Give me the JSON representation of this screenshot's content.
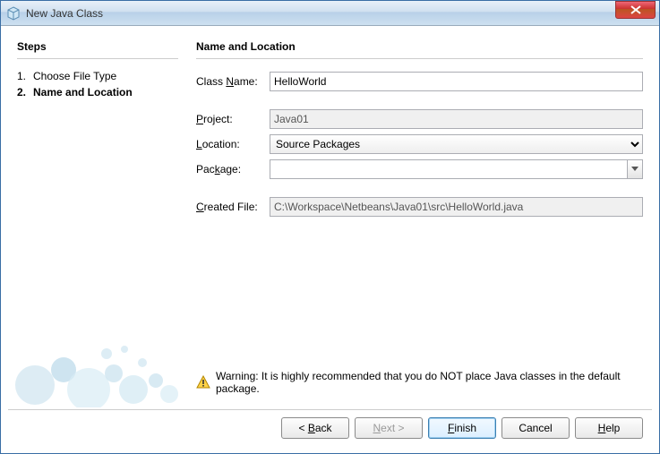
{
  "window": {
    "title": "New Java Class"
  },
  "sidebar": {
    "heading": "Steps",
    "steps": [
      {
        "num": "1.",
        "label": "Choose File Type"
      },
      {
        "num": "2.",
        "label": "Name and Location"
      }
    ],
    "current_index": 1
  },
  "main": {
    "heading": "Name and Location",
    "labels": {
      "class_name_pre": "Class ",
      "class_name_u": "N",
      "class_name_post": "ame:",
      "project_u": "P",
      "project_post": "roject:",
      "location_u": "L",
      "location_post": "ocation:",
      "package_pre": "Pac",
      "package_u": "k",
      "package_post": "age:",
      "created_u": "C",
      "created_post": "reated File:"
    },
    "values": {
      "class_name": "HelloWorld",
      "project": "Java01",
      "location": "Source Packages",
      "package": "",
      "created_file": "C:\\Workspace\\Netbeans\\Java01\\src\\HelloWorld.java"
    },
    "warning": "Warning: It is highly recommended that you do NOT place Java classes in the default package."
  },
  "buttons": {
    "back_pre": "< ",
    "back_u": "B",
    "back_post": "ack",
    "next_u": "N",
    "next_post": "ext >",
    "finish_u": "F",
    "finish_post": "inish",
    "cancel": "Cancel",
    "help_u": "H",
    "help_post": "elp"
  }
}
